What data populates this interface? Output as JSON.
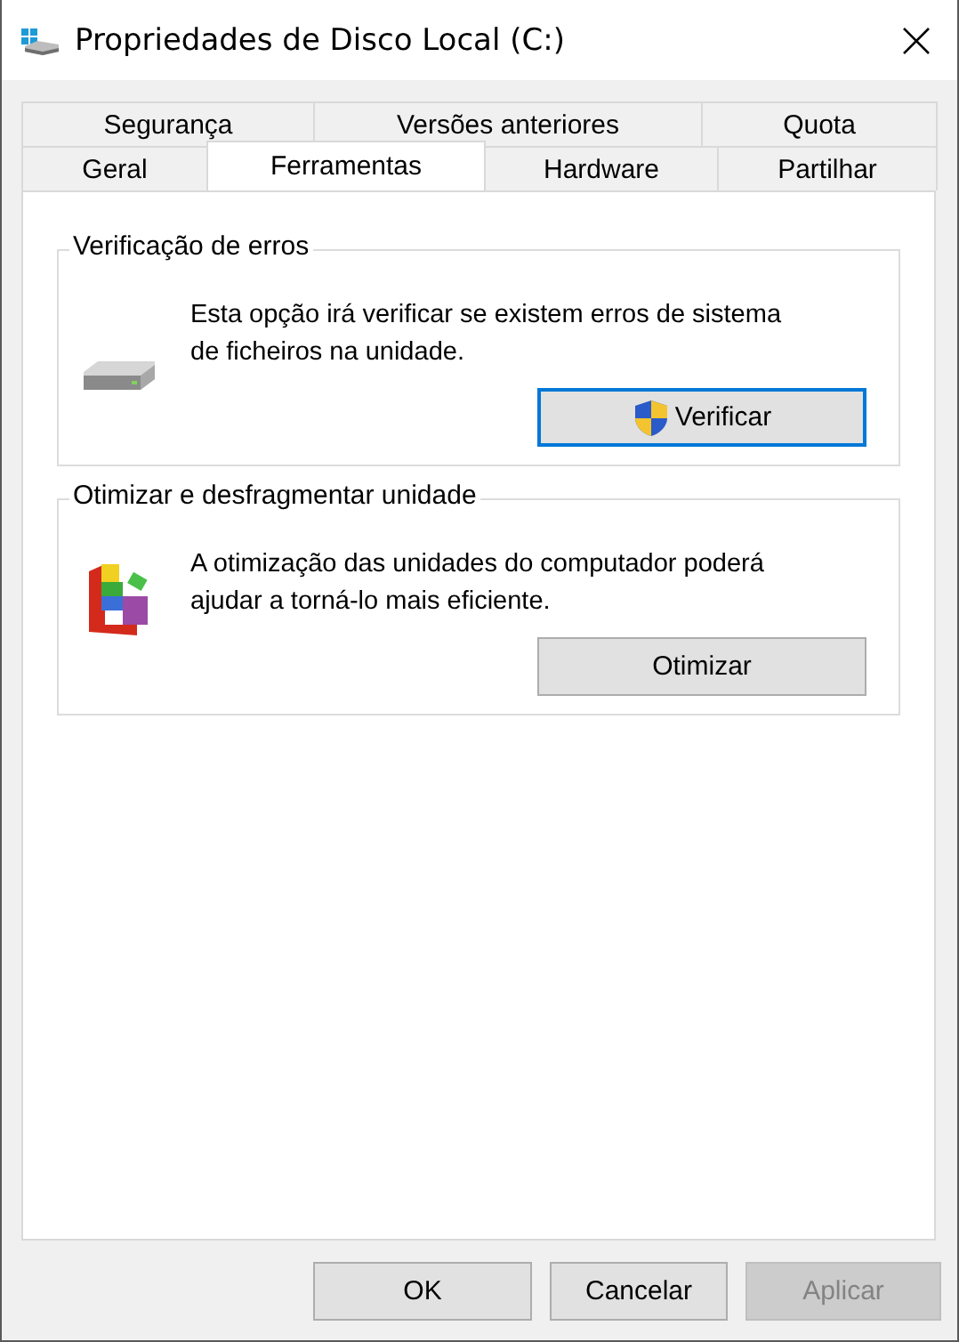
{
  "window": {
    "title": "Propriedades de Disco Local (C:)"
  },
  "tab_rows": [
    [
      {
        "label": "Segurança",
        "selected": false
      },
      {
        "label": "Versões anteriores",
        "selected": false
      },
      {
        "label": "Quota",
        "selected": false
      }
    ],
    [
      {
        "label": "Geral",
        "selected": false
      },
      {
        "label": "Ferramentas",
        "selected": true
      },
      {
        "label": "Hardware",
        "selected": false
      },
      {
        "label": "Partilhar",
        "selected": false
      }
    ]
  ],
  "groups": [
    {
      "kind": "drive",
      "title": "Verificação de erros",
      "description": "Esta opção irá verificar se existem erros de sistema de ficheiros na unidade.",
      "button": {
        "label": "Verificar",
        "focused": true,
        "elevated": true
      }
    },
    {
      "kind": "defrag",
      "title": "Otimizar e desfragmentar unidade",
      "description": "A otimização das unidades do computador poderá ajudar a torná-lo mais eficiente.",
      "button": {
        "label": "Otimizar",
        "focused": false,
        "elevated": false
      }
    }
  ],
  "buttons": [
    {
      "label": "OK",
      "disabled": false
    },
    {
      "label": "Cancelar",
      "disabled": false
    },
    {
      "label": "Aplicar",
      "disabled": true
    }
  ]
}
